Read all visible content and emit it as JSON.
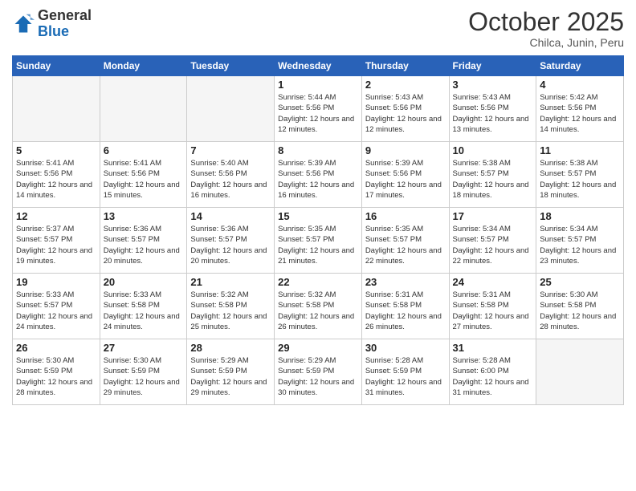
{
  "logo": {
    "general": "General",
    "blue": "Blue"
  },
  "header": {
    "month_title": "October 2025",
    "subtitle": "Chilca, Junin, Peru"
  },
  "days_of_week": [
    "Sunday",
    "Monday",
    "Tuesday",
    "Wednesday",
    "Thursday",
    "Friday",
    "Saturday"
  ],
  "weeks": [
    [
      {
        "day": "",
        "info": ""
      },
      {
        "day": "",
        "info": ""
      },
      {
        "day": "",
        "info": ""
      },
      {
        "day": "1",
        "info": "Sunrise: 5:44 AM\nSunset: 5:56 PM\nDaylight: 12 hours and 12 minutes."
      },
      {
        "day": "2",
        "info": "Sunrise: 5:43 AM\nSunset: 5:56 PM\nDaylight: 12 hours and 12 minutes."
      },
      {
        "day": "3",
        "info": "Sunrise: 5:43 AM\nSunset: 5:56 PM\nDaylight: 12 hours and 13 minutes."
      },
      {
        "day": "4",
        "info": "Sunrise: 5:42 AM\nSunset: 5:56 PM\nDaylight: 12 hours and 14 minutes."
      }
    ],
    [
      {
        "day": "5",
        "info": "Sunrise: 5:41 AM\nSunset: 5:56 PM\nDaylight: 12 hours and 14 minutes."
      },
      {
        "day": "6",
        "info": "Sunrise: 5:41 AM\nSunset: 5:56 PM\nDaylight: 12 hours and 15 minutes."
      },
      {
        "day": "7",
        "info": "Sunrise: 5:40 AM\nSunset: 5:56 PM\nDaylight: 12 hours and 16 minutes."
      },
      {
        "day": "8",
        "info": "Sunrise: 5:39 AM\nSunset: 5:56 PM\nDaylight: 12 hours and 16 minutes."
      },
      {
        "day": "9",
        "info": "Sunrise: 5:39 AM\nSunset: 5:56 PM\nDaylight: 12 hours and 17 minutes."
      },
      {
        "day": "10",
        "info": "Sunrise: 5:38 AM\nSunset: 5:57 PM\nDaylight: 12 hours and 18 minutes."
      },
      {
        "day": "11",
        "info": "Sunrise: 5:38 AM\nSunset: 5:57 PM\nDaylight: 12 hours and 18 minutes."
      }
    ],
    [
      {
        "day": "12",
        "info": "Sunrise: 5:37 AM\nSunset: 5:57 PM\nDaylight: 12 hours and 19 minutes."
      },
      {
        "day": "13",
        "info": "Sunrise: 5:36 AM\nSunset: 5:57 PM\nDaylight: 12 hours and 20 minutes."
      },
      {
        "day": "14",
        "info": "Sunrise: 5:36 AM\nSunset: 5:57 PM\nDaylight: 12 hours and 20 minutes."
      },
      {
        "day": "15",
        "info": "Sunrise: 5:35 AM\nSunset: 5:57 PM\nDaylight: 12 hours and 21 minutes."
      },
      {
        "day": "16",
        "info": "Sunrise: 5:35 AM\nSunset: 5:57 PM\nDaylight: 12 hours and 22 minutes."
      },
      {
        "day": "17",
        "info": "Sunrise: 5:34 AM\nSunset: 5:57 PM\nDaylight: 12 hours and 22 minutes."
      },
      {
        "day": "18",
        "info": "Sunrise: 5:34 AM\nSunset: 5:57 PM\nDaylight: 12 hours and 23 minutes."
      }
    ],
    [
      {
        "day": "19",
        "info": "Sunrise: 5:33 AM\nSunset: 5:57 PM\nDaylight: 12 hours and 24 minutes."
      },
      {
        "day": "20",
        "info": "Sunrise: 5:33 AM\nSunset: 5:58 PM\nDaylight: 12 hours and 24 minutes."
      },
      {
        "day": "21",
        "info": "Sunrise: 5:32 AM\nSunset: 5:58 PM\nDaylight: 12 hours and 25 minutes."
      },
      {
        "day": "22",
        "info": "Sunrise: 5:32 AM\nSunset: 5:58 PM\nDaylight: 12 hours and 26 minutes."
      },
      {
        "day": "23",
        "info": "Sunrise: 5:31 AM\nSunset: 5:58 PM\nDaylight: 12 hours and 26 minutes."
      },
      {
        "day": "24",
        "info": "Sunrise: 5:31 AM\nSunset: 5:58 PM\nDaylight: 12 hours and 27 minutes."
      },
      {
        "day": "25",
        "info": "Sunrise: 5:30 AM\nSunset: 5:58 PM\nDaylight: 12 hours and 28 minutes."
      }
    ],
    [
      {
        "day": "26",
        "info": "Sunrise: 5:30 AM\nSunset: 5:59 PM\nDaylight: 12 hours and 28 minutes."
      },
      {
        "day": "27",
        "info": "Sunrise: 5:30 AM\nSunset: 5:59 PM\nDaylight: 12 hours and 29 minutes."
      },
      {
        "day": "28",
        "info": "Sunrise: 5:29 AM\nSunset: 5:59 PM\nDaylight: 12 hours and 29 minutes."
      },
      {
        "day": "29",
        "info": "Sunrise: 5:29 AM\nSunset: 5:59 PM\nDaylight: 12 hours and 30 minutes."
      },
      {
        "day": "30",
        "info": "Sunrise: 5:28 AM\nSunset: 5:59 PM\nDaylight: 12 hours and 31 minutes."
      },
      {
        "day": "31",
        "info": "Sunrise: 5:28 AM\nSunset: 6:00 PM\nDaylight: 12 hours and 31 minutes."
      },
      {
        "day": "",
        "info": ""
      }
    ]
  ]
}
